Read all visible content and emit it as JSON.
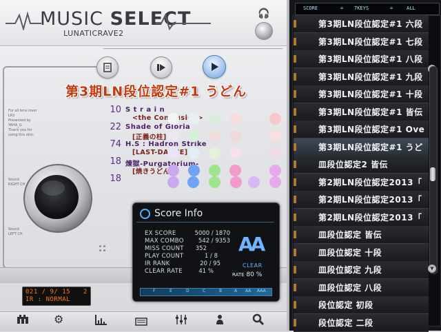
{
  "header": {
    "title_prefix": "MUSIC",
    "title_bold": "SELECT",
    "subtitle": "LUNATICRAVE2"
  },
  "toolbar": {
    "memo_icon": "memo-icon",
    "next_icon": "skip-icon",
    "play_icon": "play-icon"
  },
  "course": {
    "title": "第3期LN段位認定#1 うどん"
  },
  "songs": [
    {
      "level": "10",
      "title": "S t r a i n",
      "subtitle": "<the Conclusion>"
    },
    {
      "level": "22",
      "title": "Shade of Gloria",
      "subtitle": "[正義の柱]"
    },
    {
      "level": "74",
      "title": "H.S : Hadron Strike",
      "subtitle": "[LAST-DANCE]"
    },
    {
      "level": "18",
      "title": "煉獄-Purgatorium-",
      "subtitle": "[焼きうどん]"
    },
    {
      "level": "18",
      "title": "",
      "subtitle": ""
    }
  ],
  "dot_colors": [
    "#f4f5f7",
    "#e9eef5",
    "#dbeedd",
    "#f6dede",
    "#f5c9c9",
    "#ede8f0",
    "#d6f1d8",
    "#f3dcdc",
    "#eedada",
    "#fbdede",
    "#eae4f6",
    "#e2f0f5",
    "#e3f3d9",
    "#f6e1ea",
    "#efdbe8",
    "#c9a8f0",
    "#6fa4f5",
    "#9fe38f",
    "#f39acd",
    "#e5a8ea"
  ],
  "side_text": {
    "credits": [
      "For all bms lover",
      "LR2",
      "Presented by",
      "YAHA_G",
      "Thank you for",
      "using this skin."
    ],
    "sound_top": [
      "Sound",
      "RIGHT CH"
    ],
    "sound_bottom": [
      "Sound",
      "LEFT CH"
    ]
  },
  "led": {
    "line1_date": "021 / 9/ 15",
    "line1_count": "2",
    "line2": "IR : NORMAL"
  },
  "score_info": {
    "title": "Score Info",
    "rows": [
      {
        "label": "EX SCORE",
        "value": "5000 / 1870"
      },
      {
        "label": "MAX COMBO",
        "value": "542 / 9353"
      },
      {
        "label": "MISS COUNT",
        "value": "352"
      },
      {
        "label": "PLAY COUNT",
        "value": "1 / 8"
      },
      {
        "label": "IR RANK",
        "value": "20 / 95"
      },
      {
        "label": "CLEAR RATE",
        "value": "41 %"
      }
    ],
    "clear_logo": "AA",
    "clear_label": "CLEAR",
    "rate_label": "RATE",
    "rate_value": "80 %",
    "grades": [
      "F",
      "E",
      "D",
      "C",
      "B",
      "A",
      "AA",
      "AAA"
    ]
  },
  "list_header": {
    "score": "SCORE",
    "sep1": "=",
    "keys": "7KEYS",
    "sep2": "=",
    "all": "ALL"
  },
  "song_list": [
    "第3期LN段位認定#1 六段",
    "第3期LN段位認定#1 七段",
    "第3期LN段位認定#1 八段",
    "第3期LN段位認定#1 九段",
    "第3期LN段位認定#1 十段",
    "第3期LN段位認定#1 皆伝",
    "第3期LN段位認定#1 Ove",
    "第3期LN段位認定#1 うど",
    "皿段位認定2 皆伝",
    "第2期LN段位認定2013「",
    "第2期LN段位認定2013「",
    "第2期LN段位認定2013「",
    "皿段位認定 皆伝",
    "皿段位認定 十段",
    "皿段位認定 九段",
    "皿段位認定 八段",
    "段位認定 初段",
    "段位認定 二段"
  ],
  "bottom_icons": [
    "keys-icon",
    "gear-icon",
    "chart-icon",
    "keyboard-icon",
    "equalizer-icon",
    "person-icon",
    "search-icon"
  ],
  "colors": {
    "accent_blue": "#6fb4ff",
    "title_red": "#c43a10",
    "led_orange": "#ff7a10"
  }
}
